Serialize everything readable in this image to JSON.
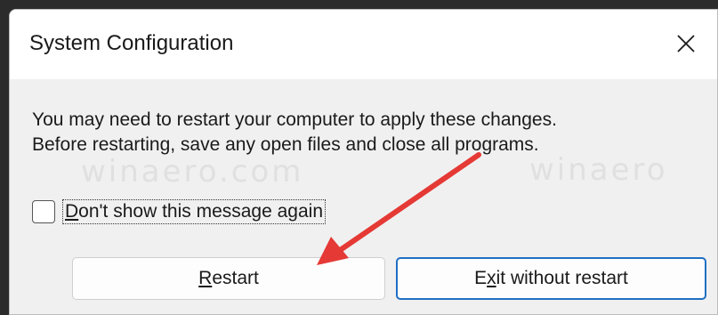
{
  "dialog": {
    "title": "System Configuration",
    "close_icon": "close-icon",
    "message_line1": "You may need to restart your computer to apply these changes.",
    "message_line2": "Before restarting, save any open files and close all programs.",
    "checkbox_label_first": "D",
    "checkbox_label_rest": "on't show this message again",
    "checkbox_checked": false,
    "restart_mnemonic": "R",
    "restart_rest": "estart",
    "exit_prefix": "E",
    "exit_mnemonic": "x",
    "exit_rest": "it without restart"
  },
  "watermark": {
    "text_left": "winaero.com",
    "text_right": "winaero"
  },
  "colors": {
    "accent": "#1f6fc4",
    "annotation_arrow": "#e53935"
  }
}
